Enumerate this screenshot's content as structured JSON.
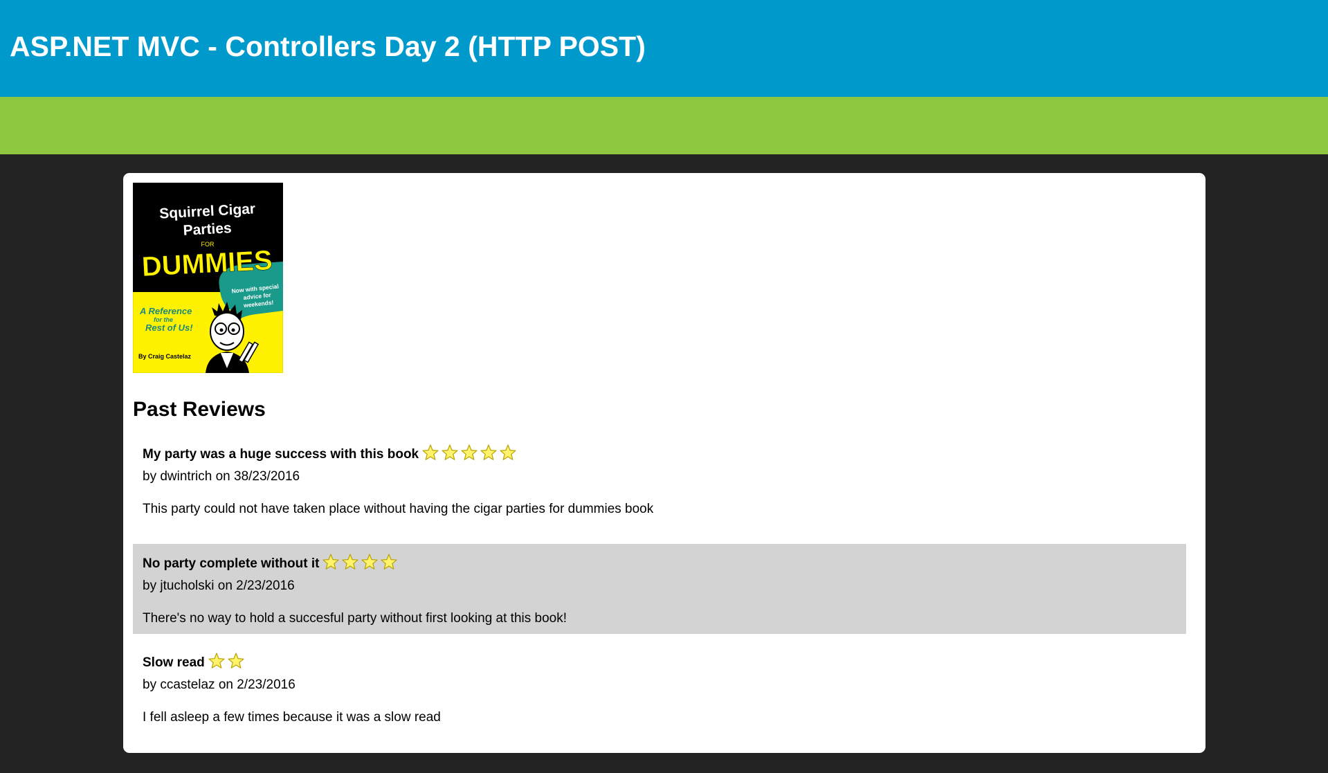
{
  "header": {
    "title": "ASP.NET MVC - Controllers Day 2 (HTTP POST)"
  },
  "book": {
    "cover": {
      "title_line1": "Squirrel Cigar",
      "title_line2": "Parties",
      "for": "FOR",
      "brand": "DUMMIES",
      "tagline_line1": "A Reference",
      "tagline_line2": "for the",
      "tagline_line3": "Rest of Us!",
      "bubble_line1": "Now with special",
      "bubble_line2": "advice for",
      "bubble_line3": "weekends!",
      "author": "By Craig Castelaz"
    }
  },
  "reviews_section": {
    "heading": "Past Reviews"
  },
  "reviews": [
    {
      "title": "My party was a huge success with this book",
      "rating": 5,
      "byline": "by dwintrich on 38/23/2016",
      "body": "This party could not have taken place without having the cigar parties for dummies book"
    },
    {
      "title": "No party complete without it",
      "rating": 4,
      "byline": "by jtucholski on 2/23/2016",
      "body": "There's no way to hold a succesful party without first looking at this book!"
    },
    {
      "title": "Slow read",
      "rating": 2,
      "byline": "by ccastelaz on 2/23/2016",
      "body": "I fell asleep a few times because it was a slow read"
    }
  ],
  "colors": {
    "header_bg": "#0099cc",
    "nav_bg": "#8dc63f",
    "page_bg": "#222222",
    "card_bg": "#ffffff",
    "alt_row_bg": "#d3d3d3",
    "star_fill": "#fff36b"
  },
  "icons": {
    "rating": "star-icon"
  }
}
